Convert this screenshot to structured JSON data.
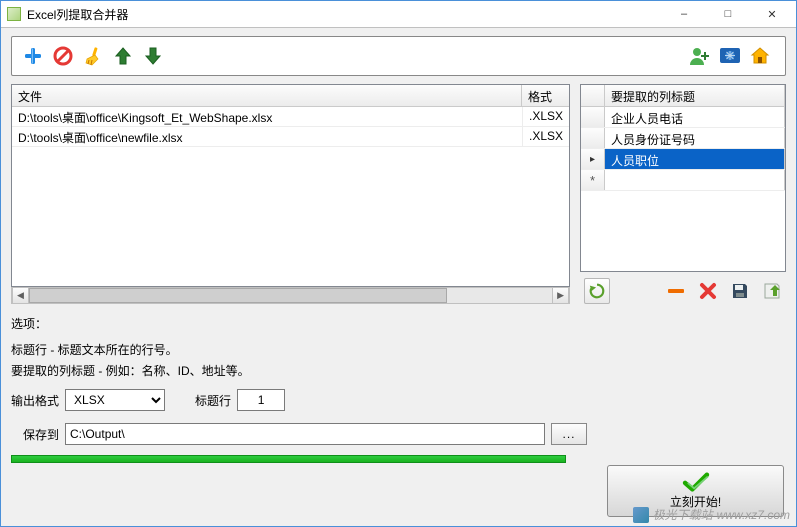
{
  "window": {
    "title": "Excel列提取合并器"
  },
  "toolbar": {
    "icons": [
      "plus",
      "forbid",
      "broom",
      "up",
      "down"
    ],
    "right_icons": [
      "user-add",
      "flag",
      "home"
    ]
  },
  "file_grid": {
    "headers": {
      "file": "文件",
      "format": "格式"
    },
    "rows": [
      {
        "file": "D:\\tools\\桌面\\office\\Kingsoft_Et_WebShape.xlsx",
        "format": ".XLSX"
      },
      {
        "file": "D:\\tools\\桌面\\office\\newfile.xlsx",
        "format": ".XLSX"
      }
    ]
  },
  "column_grid": {
    "header": "要提取的列标题",
    "rows": [
      {
        "text": "企业人员电话",
        "state": ""
      },
      {
        "text": "人员身份证号码",
        "state": ""
      },
      {
        "text": "人员职位",
        "state": "selected"
      },
      {
        "text": "",
        "state": "newrow"
      }
    ]
  },
  "options": {
    "label": "选项：",
    "line1": "标题行 - 标题文本所在的行号。",
    "line2": "要提取的列标题 - 例如：名称、ID、地址等。"
  },
  "form": {
    "output_format_label": "输出格式",
    "output_format_value": "XLSX",
    "header_row_label": "标题行",
    "header_row_value": "1",
    "save_to_label": "保存到",
    "save_to_value": "C:\\Output\\",
    "browse_label": "..."
  },
  "start_button": {
    "label": "立刻开始!"
  },
  "watermark": {
    "text": "极光下载站",
    "url": "www.xz7.com"
  }
}
